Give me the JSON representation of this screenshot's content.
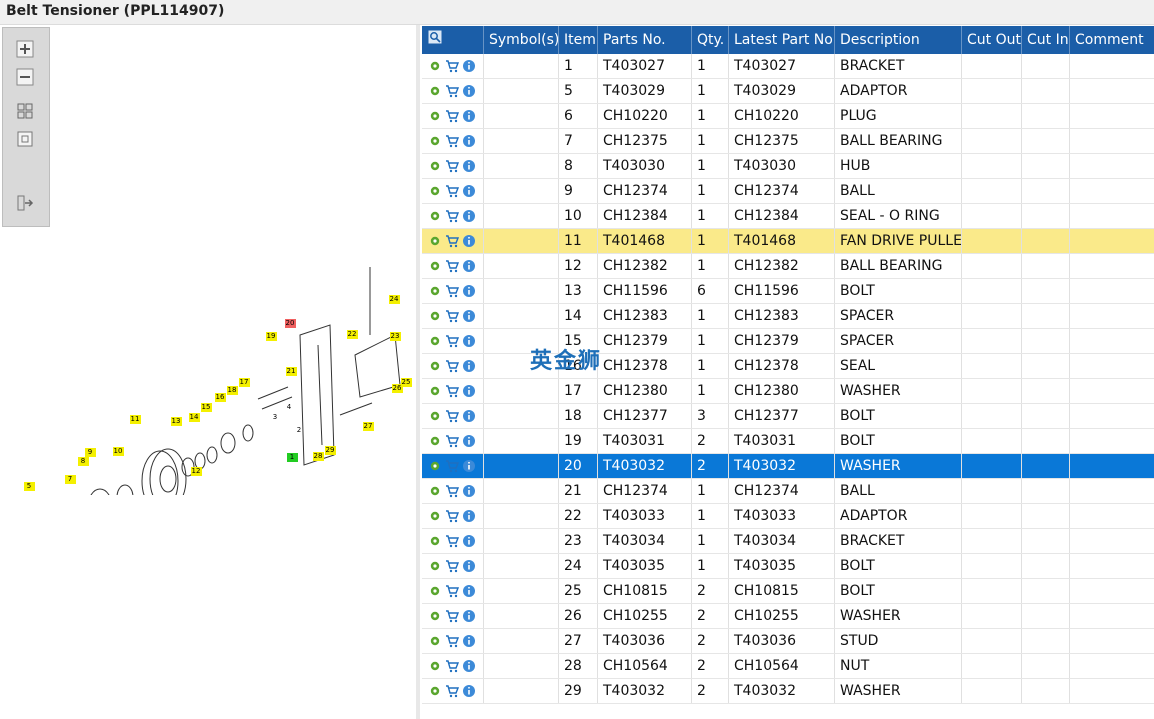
{
  "window": {
    "title": "Belt Tensioner (PPL114907)"
  },
  "toolbox": {
    "buttons": [
      "zoom-in-icon",
      "zoom-out-icon",
      "fit-all-icon",
      "fit-page-icon",
      "export-icon"
    ]
  },
  "diagram": {
    "callouts": [
      {
        "label": "1",
        "highlight": "#22cc22"
      },
      {
        "label": "2",
        "highlight": ""
      },
      {
        "label": "3",
        "highlight": ""
      },
      {
        "label": "4",
        "highlight": ""
      },
      {
        "label": "5",
        "highlight": "#f4f000"
      },
      {
        "label": "6",
        "highlight": "#f4f000"
      },
      {
        "label": "7",
        "highlight": "#f4f000"
      },
      {
        "label": "8",
        "highlight": "#f4f000"
      },
      {
        "label": "9",
        "highlight": "#f4f000"
      },
      {
        "label": "10",
        "highlight": "#f4f000"
      },
      {
        "label": "11",
        "highlight": "#f4f000"
      },
      {
        "label": "12",
        "highlight": "#f4f000"
      },
      {
        "label": "13",
        "highlight": "#f4f000"
      },
      {
        "label": "14",
        "highlight": "#f4f000"
      },
      {
        "label": "15",
        "highlight": "#f4f000"
      },
      {
        "label": "16",
        "highlight": "#f4f000"
      },
      {
        "label": "17",
        "highlight": "#f4f000"
      },
      {
        "label": "18",
        "highlight": "#f4f000"
      },
      {
        "label": "19",
        "highlight": "#f4f000"
      },
      {
        "label": "20",
        "highlight": "#f06060"
      },
      {
        "label": "21",
        "highlight": "#f4f000"
      },
      {
        "label": "22",
        "highlight": "#f4f000"
      },
      {
        "label": "23",
        "highlight": "#f4f000"
      },
      {
        "label": "24",
        "highlight": "#f4f000"
      },
      {
        "label": "25",
        "highlight": "#f4f000"
      },
      {
        "label": "26",
        "highlight": "#f4f000"
      },
      {
        "label": "27",
        "highlight": "#f4f000"
      },
      {
        "label": "28",
        "highlight": "#f4f000"
      },
      {
        "label": "29",
        "highlight": "#f4f000"
      }
    ]
  },
  "table": {
    "columns": [
      "Symbol(s)",
      "Item",
      "Parts No.",
      "Qty.",
      "Latest Part No.",
      "Description",
      "Cut Out",
      "Cut In",
      "Comment"
    ],
    "rows": [
      {
        "item": "1",
        "part": "T403027",
        "qty": "1",
        "latest": "T403027",
        "desc": "BRACKET",
        "state": ""
      },
      {
        "item": "5",
        "part": "T403029",
        "qty": "1",
        "latest": "T403029",
        "desc": "ADAPTOR",
        "state": ""
      },
      {
        "item": "6",
        "part": "CH10220",
        "qty": "1",
        "latest": "CH10220",
        "desc": "PLUG",
        "state": ""
      },
      {
        "item": "7",
        "part": "CH12375",
        "qty": "1",
        "latest": "CH12375",
        "desc": "BALL BEARING",
        "state": ""
      },
      {
        "item": "8",
        "part": "T403030",
        "qty": "1",
        "latest": "T403030",
        "desc": "HUB",
        "state": ""
      },
      {
        "item": "9",
        "part": "CH12374",
        "qty": "1",
        "latest": "CH12374",
        "desc": "BALL",
        "state": ""
      },
      {
        "item": "10",
        "part": "CH12384",
        "qty": "1",
        "latest": "CH12384",
        "desc": "SEAL - O RING",
        "state": ""
      },
      {
        "item": "11",
        "part": "T401468",
        "qty": "1",
        "latest": "T401468",
        "desc": "FAN DRIVE PULLEY",
        "state": "yellow"
      },
      {
        "item": "12",
        "part": "CH12382",
        "qty": "1",
        "latest": "CH12382",
        "desc": "BALL BEARING",
        "state": ""
      },
      {
        "item": "13",
        "part": "CH11596",
        "qty": "6",
        "latest": "CH11596",
        "desc": "BOLT",
        "state": ""
      },
      {
        "item": "14",
        "part": "CH12383",
        "qty": "1",
        "latest": "CH12383",
        "desc": "SPACER",
        "state": ""
      },
      {
        "item": "15",
        "part": "CH12379",
        "qty": "1",
        "latest": "CH12379",
        "desc": "SPACER",
        "state": ""
      },
      {
        "item": "16",
        "part": "CH12378",
        "qty": "1",
        "latest": "CH12378",
        "desc": "SEAL",
        "state": ""
      },
      {
        "item": "17",
        "part": "CH12380",
        "qty": "1",
        "latest": "CH12380",
        "desc": "WASHER",
        "state": ""
      },
      {
        "item": "18",
        "part": "CH12377",
        "qty": "3",
        "latest": "CH12377",
        "desc": "BOLT",
        "state": ""
      },
      {
        "item": "19",
        "part": "T403031",
        "qty": "2",
        "latest": "T403031",
        "desc": "BOLT",
        "state": ""
      },
      {
        "item": "20",
        "part": "T403032",
        "qty": "2",
        "latest": "T403032",
        "desc": "WASHER",
        "state": "blue"
      },
      {
        "item": "21",
        "part": "CH12374",
        "qty": "1",
        "latest": "CH12374",
        "desc": "BALL",
        "state": ""
      },
      {
        "item": "22",
        "part": "T403033",
        "qty": "1",
        "latest": "T403033",
        "desc": "ADAPTOR",
        "state": ""
      },
      {
        "item": "23",
        "part": "T403034",
        "qty": "1",
        "latest": "T403034",
        "desc": "BRACKET",
        "state": ""
      },
      {
        "item": "24",
        "part": "T403035",
        "qty": "1",
        "latest": "T403035",
        "desc": "BOLT",
        "state": ""
      },
      {
        "item": "25",
        "part": "CH10815",
        "qty": "2",
        "latest": "CH10815",
        "desc": "BOLT",
        "state": ""
      },
      {
        "item": "26",
        "part": "CH10255",
        "qty": "2",
        "latest": "CH10255",
        "desc": "WASHER",
        "state": ""
      },
      {
        "item": "27",
        "part": "T403036",
        "qty": "2",
        "latest": "T403036",
        "desc": "STUD",
        "state": ""
      },
      {
        "item": "28",
        "part": "CH10564",
        "qty": "2",
        "latest": "CH10564",
        "desc": "NUT",
        "state": ""
      },
      {
        "item": "29",
        "part": "T403032",
        "qty": "2",
        "latest": "T403032",
        "desc": "WASHER",
        "state": ""
      }
    ]
  },
  "watermark": "英金狮"
}
